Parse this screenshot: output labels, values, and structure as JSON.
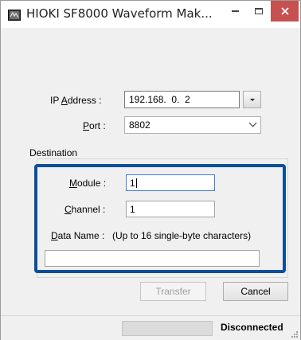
{
  "window": {
    "title": "HIOKI SF8000 Waveform Mak...",
    "icon": "hioki-app-icon",
    "controls": {
      "minimize": "minimize-icon",
      "maximize": "maximize-icon",
      "close": "close-icon",
      "close_color": "#c75050"
    }
  },
  "connection": {
    "ip_label_pre": "IP ",
    "ip_label_mnemonic": "A",
    "ip_label_post": "ddress :",
    "ip_value": "192.168.  0.  2",
    "port_label_mnemonic": "P",
    "port_label_post": "ort :",
    "port_value": "8802"
  },
  "destination": {
    "group_label": "Destination",
    "highlight_color": "#0a4f9c",
    "module_label_mnemonic": "M",
    "module_label_post": "odule :",
    "module_value": "1",
    "channel_label_mnemonic": "C",
    "channel_label_post": "hannel :",
    "channel_value": "1",
    "dataname_label_mnemonic": "D",
    "dataname_label_post": "ata Name :",
    "dataname_hint": "(Up to 16 single-byte characters)",
    "dataname_value": ""
  },
  "buttons": {
    "transfer": "Transfer",
    "cancel": "Cancel"
  },
  "status": {
    "text": "Disconnected"
  }
}
